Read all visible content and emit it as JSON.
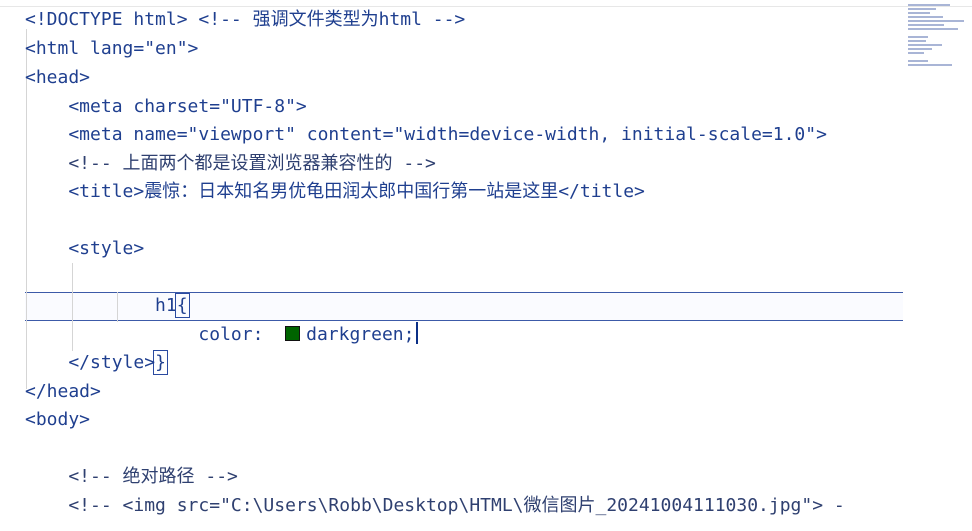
{
  "lines": [
    {
      "text": "<!DOCTYPE html> <!-- 强调文件类型为html -->"
    },
    {
      "text": "<html lang=\"en\">"
    },
    {
      "text": "<head>"
    },
    {
      "text": "    <meta charset=\"UTF-8\">"
    },
    {
      "text": "    <meta name=\"viewport\" content=\"width=device-width, initial-scale=1.0\">"
    },
    {
      "text": "    <!-- 上面两个都是设置浏览器兼容性的 -->"
    },
    {
      "text": "    <title>震惊：日本知名男优龟田润太郎中国行第一站是这里</title>"
    },
    {
      "text": ""
    },
    {
      "text": "    <style>"
    },
    {
      "text": "        h1",
      "brace": "{"
    },
    {
      "prefix": "            color:  ",
      "value": "darkgreen",
      "suffix": ";"
    },
    {
      "text": "        ",
      "brace": "}"
    },
    {
      "text": "    </style>"
    },
    {
      "text": "</head>"
    },
    {
      "text": "<body>"
    },
    {
      "text": ""
    },
    {
      "text": "    <!-- 绝对路径 -->"
    },
    {
      "text": "    <!-- <img src=\"C:\\Users\\Robb\\Desktop\\HTML\\微信图片_20241004111030.jpg\"> -"
    }
  ],
  "colors": {
    "swatch": "#006400",
    "keyword": "#1f3f8f",
    "background": "#ffffff"
  }
}
